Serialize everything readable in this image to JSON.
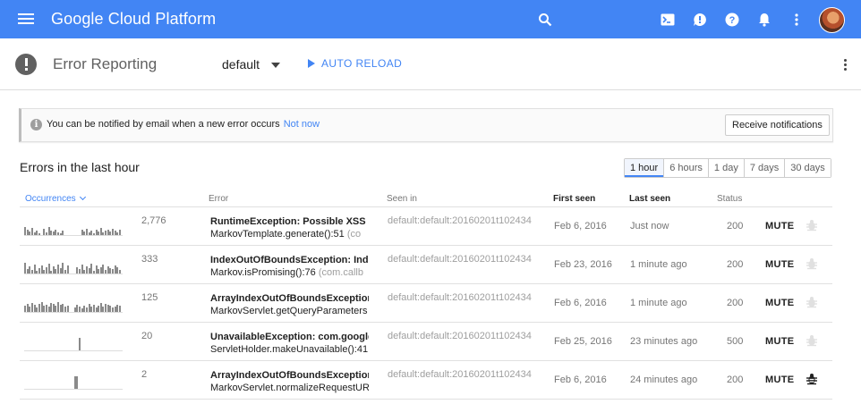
{
  "topbar": {
    "brand": "Google Cloud Platform",
    "icons": [
      "menu-icon",
      "search-icon",
      "cloud-shell-icon",
      "feedback-icon",
      "help-icon",
      "notifications-icon",
      "more-vert-icon",
      "avatar"
    ],
    "color": "#4285f4"
  },
  "subbar": {
    "title": "Error Reporting",
    "project": "default",
    "autoreload": "AUTO RELOAD"
  },
  "notice": {
    "text": "You can be notified by email when a new error occurs",
    "not_now": "Not now",
    "button": "Receive notifications"
  },
  "section": {
    "title": "Errors in the last hour",
    "ranges": [
      "1 hour",
      "6 hours",
      "1 day",
      "7 days",
      "30 days"
    ],
    "selected_range": "1 hour"
  },
  "table": {
    "headers": {
      "occurrences": "Occurrences",
      "error": "Error",
      "seen_in": "Seen in",
      "first_seen": "First seen",
      "last_seen": "Last seen",
      "status": "Status"
    },
    "rows": [
      {
        "count": "2,776",
        "error_line1": "RuntimeException: Possible XSS at",
        "error_line2": "MarkovTemplate.generate():51",
        "error_line2_extra": " (co",
        "seen_in": "default:default:20160201t102434",
        "first_seen": "Feb 6, 2016",
        "last_seen": "Just now",
        "status": "200",
        "action": "MUTE",
        "bug_active": false
      },
      {
        "count": "333",
        "error_line1": "IndexOutOfBoundsException: Inde",
        "error_line2": "Markov.isPromising():76",
        "error_line2_extra": " (com.callb",
        "seen_in": "default:default:20160201t102434",
        "first_seen": "Feb 23, 2016",
        "last_seen": "1 minute ago",
        "status": "200",
        "action": "MUTE",
        "bug_active": false
      },
      {
        "count": "125",
        "error_line1": "ArrayIndexOutOfBoundsException:",
        "error_line2": "MarkovServlet.getQueryParameters",
        "error_line2_extra": "",
        "seen_in": "default:default:20160201t102434",
        "first_seen": "Feb 6, 2016",
        "last_seen": "1 minute ago",
        "status": "200",
        "action": "MUTE",
        "bug_active": false
      },
      {
        "count": "20",
        "error_line1": "UnavailableException: com.google.",
        "error_line2": "ServletHolder.makeUnavailable():41",
        "error_line2_extra": "",
        "seen_in": "default:default:20160201t102434",
        "first_seen": "Feb 25, 2016",
        "last_seen": "23 minutes ago",
        "status": "500",
        "action": "MUTE",
        "bug_active": false
      },
      {
        "count": "2",
        "error_line1": "ArrayIndexOutOfBoundsException:",
        "error_line2": "MarkovServlet.normalizeRequestUR",
        "error_line2_extra": "",
        "seen_in": "default:default:20160201t102434",
        "first_seen": "Feb 6, 2016",
        "last_seen": "24 minutes ago",
        "status": "200",
        "action": "MUTE",
        "bug_active": true
      }
    ]
  }
}
